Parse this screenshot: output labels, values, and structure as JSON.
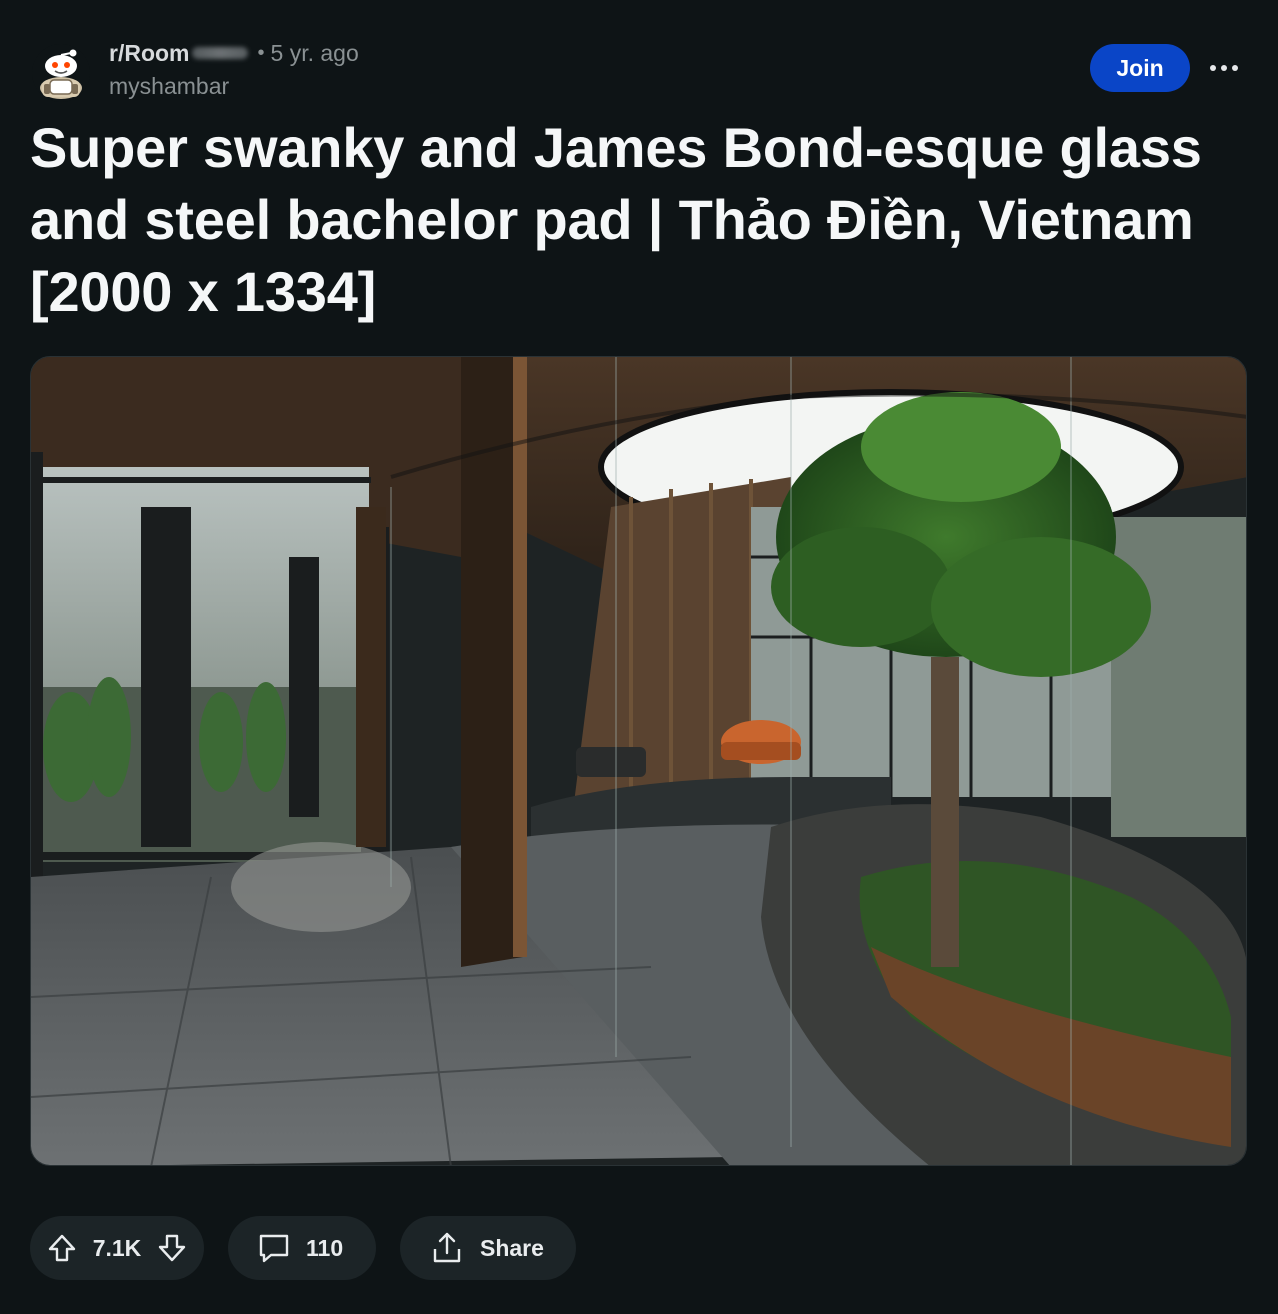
{
  "post": {
    "subreddit": "r/Room",
    "time_ago": "5 yr. ago",
    "author": "myshambar",
    "join_label": "Join",
    "more_icon": "more-horizontal-icon",
    "title": "Super swanky and James Bond-esque glass and steel bachelor pad | Thảo Điền, Vietnam [2000 x 1334]"
  },
  "actions": {
    "vote_count": "7.1K",
    "comment_count": "110",
    "share_label": "Share",
    "icons": [
      "upvote-icon",
      "downvote-icon",
      "comment-icon",
      "share-icon"
    ]
  },
  "colors": {
    "background": "#0e1416",
    "join_button": "#0a45c7",
    "pill": "#1c2427",
    "muted_text": "#8a9193"
  }
}
